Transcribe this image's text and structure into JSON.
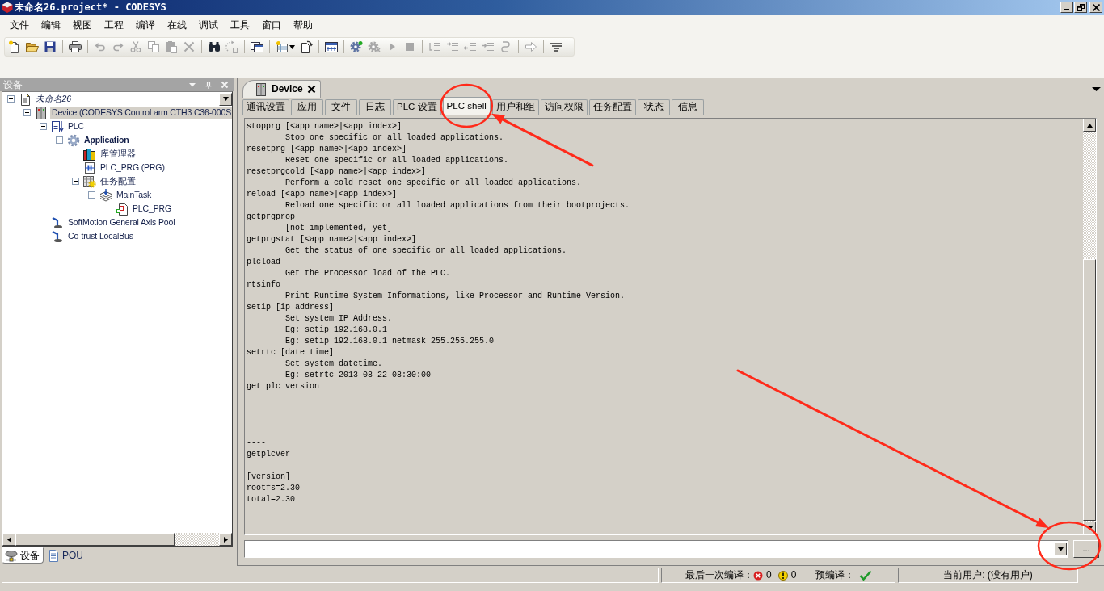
{
  "window": {
    "title": "未命名26.project* - CODESYS"
  },
  "menu": [
    "文件",
    "编辑",
    "视图",
    "工程",
    "编译",
    "在线",
    "调试",
    "工具",
    "窗口",
    "帮助"
  ],
  "toolbar": {
    "groups": [
      [
        {
          "kind": "new",
          "disabled": false
        },
        {
          "kind": "open",
          "disabled": false
        },
        {
          "kind": "save",
          "disabled": false
        }
      ],
      [
        {
          "kind": "print",
          "disabled": false
        }
      ],
      [
        {
          "kind": "undo",
          "disabled": true
        },
        {
          "kind": "redo",
          "disabled": true
        },
        {
          "kind": "cut",
          "disabled": true
        },
        {
          "kind": "copy",
          "disabled": true
        },
        {
          "kind": "paste",
          "disabled": true
        },
        {
          "kind": "delete",
          "disabled": true
        }
      ],
      [
        {
          "kind": "find",
          "disabled": false
        },
        {
          "kind": "replace",
          "disabled": true
        }
      ],
      [
        {
          "kind": "windows",
          "disabled": false
        }
      ],
      [
        {
          "kind": "insert",
          "disabled": false,
          "dropdown": true
        },
        {
          "kind": "refresh",
          "disabled": false
        }
      ],
      [
        {
          "kind": "build",
          "disabled": false
        }
      ],
      [
        {
          "kind": "login",
          "disabled": false
        },
        {
          "kind": "logout",
          "disabled": true
        },
        {
          "kind": "start",
          "disabled": true
        },
        {
          "kind": "stop",
          "disabled": true
        }
      ],
      [
        {
          "kind": "stepover",
          "disabled": true
        },
        {
          "kind": "stepinto",
          "disabled": true
        },
        {
          "kind": "stepout",
          "disabled": true
        },
        {
          "kind": "runto",
          "disabled": true
        },
        {
          "kind": "nextstatement",
          "disabled": true
        }
      ],
      [
        {
          "kind": "forward",
          "disabled": true
        }
      ],
      [
        {
          "kind": "filter",
          "disabled": false
        }
      ]
    ]
  },
  "devices_panel": {
    "title": "设备",
    "tree": [
      {
        "label": "未命名26",
        "kind": "project",
        "expanded": true,
        "selected": false,
        "active": false,
        "children": [
          {
            "label": "Device (CODESYS Control arm CTH3 C36-000S",
            "kind": "device",
            "expanded": true,
            "selected": true,
            "active": false,
            "children": [
              {
                "label": "PLC",
                "kind": "plc",
                "expanded": true,
                "selected": false,
                "active": false,
                "children": [
                  {
                    "label": "Application",
                    "kind": "application",
                    "expanded": true,
                    "selected": false,
                    "active": true,
                    "children": [
                      {
                        "label": "库管理器",
                        "kind": "library",
                        "selected": false,
                        "active": false
                      },
                      {
                        "label": "PLC_PRG (PRG)",
                        "kind": "pou",
                        "selected": false,
                        "active": false
                      },
                      {
                        "label": "任务配置",
                        "kind": "taskconfig",
                        "expanded": true,
                        "selected": false,
                        "active": false,
                        "children": [
                          {
                            "label": "MainTask",
                            "kind": "task",
                            "expanded": true,
                            "selected": false,
                            "active": false,
                            "children": [
                              {
                                "label": "PLC_PRG",
                                "kind": "call",
                                "selected": false,
                                "active": false
                              }
                            ]
                          }
                        ]
                      }
                    ]
                  }
                ]
              },
              {
                "label": "SoftMotion General Axis Pool",
                "kind": "motion",
                "selected": false,
                "active": false
              },
              {
                "label": "Co-trust LocalBus",
                "kind": "bus",
                "selected": false,
                "active": false
              }
            ]
          }
        ]
      }
    ],
    "bottom_tabs": [
      {
        "label": "设备",
        "kind": "devices",
        "selected": true
      },
      {
        "label": "POU",
        "kind": "pou",
        "selected": false
      }
    ]
  },
  "editor": {
    "document_tabs": [
      {
        "label": "Device",
        "selected": true
      }
    ],
    "tabs": [
      {
        "label": "通讯设置",
        "selected": false
      },
      {
        "label": "应用",
        "selected": false
      },
      {
        "label": "文件",
        "selected": false
      },
      {
        "label": "日志",
        "selected": false
      },
      {
        "label": "PLC 设置",
        "selected": false
      },
      {
        "label": "PLC shell",
        "selected": true
      },
      {
        "label": "用户和组",
        "selected": false
      },
      {
        "label": "访问权限",
        "selected": false
      },
      {
        "label": "任务配置",
        "selected": false
      },
      {
        "label": "状态",
        "selected": false
      },
      {
        "label": "信息",
        "selected": false
      }
    ],
    "console_lines": [
      {
        "kind": "command",
        "text": "stopprg [<app name>|<app index>]"
      },
      {
        "kind": "description",
        "text": "Stop one specific or all loaded applications."
      },
      {
        "kind": "command",
        "text": "resetprg [<app name>|<app index>]"
      },
      {
        "kind": "description",
        "text": "Reset one specific or all loaded applications."
      },
      {
        "kind": "command",
        "text": "resetprgcold [<app name>|<app index>]"
      },
      {
        "kind": "description",
        "text": "Perform a cold reset one specific or all loaded applications."
      },
      {
        "kind": "command",
        "text": "reload [<app name>|<app index>]"
      },
      {
        "kind": "description",
        "text": "Reload one specific or all loaded applications from their bootprojects."
      },
      {
        "kind": "command",
        "text": "getprgprop"
      },
      {
        "kind": "description",
        "text": "[not implemented, yet]"
      },
      {
        "kind": "command",
        "text": "getprgstat [<app name>|<app index>]"
      },
      {
        "kind": "description",
        "text": "Get the status of one specific or all loaded applications."
      },
      {
        "kind": "command",
        "text": "plcload"
      },
      {
        "kind": "description",
        "text": "Get the Processor load of the PLC."
      },
      {
        "kind": "command",
        "text": "rtsinfo"
      },
      {
        "kind": "description",
        "text": "Print Runtime System Informations, like Processor and Runtime Version."
      },
      {
        "kind": "command",
        "text": "setip [ip address]"
      },
      {
        "kind": "description",
        "text": "Set system IP Address."
      },
      {
        "kind": "description",
        "text": "Eg: setip 192.168.0.1"
      },
      {
        "kind": "description",
        "text": "Eg: setip 192.168.0.1 netmask 255.255.255.0"
      },
      {
        "kind": "command",
        "text": "setrtc [date time]"
      },
      {
        "kind": "description",
        "text": "Set system datetime."
      },
      {
        "kind": "description",
        "text": "Eg: setrtc 2013-08-22 08:30:00"
      },
      {
        "kind": "command",
        "text": "get plc version"
      },
      {
        "kind": "blank"
      },
      {
        "kind": "blank"
      },
      {
        "kind": "blank"
      },
      {
        "kind": "blank"
      },
      {
        "kind": "command",
        "text": "----"
      },
      {
        "kind": "command",
        "text": "getplcver"
      },
      {
        "kind": "blank"
      },
      {
        "kind": "command",
        "text": "[version]"
      },
      {
        "kind": "command",
        "text": "rootfs=2.30"
      },
      {
        "kind": "command",
        "text": "total=2.30"
      }
    ],
    "more_button": {
      "label": "..."
    }
  },
  "status_bar": {
    "last_build_label": "最后一次编译：",
    "errors": "0",
    "warnings": "0",
    "precompile_label": "预编译：",
    "precompile_ok": true,
    "user": "当前用户: (没有用户)"
  },
  "annotations": [
    {
      "kind": "ellipse"
    },
    {
      "kind": "arrow"
    },
    {
      "kind": "arrow"
    },
    {
      "kind": "ellipse"
    }
  ]
}
